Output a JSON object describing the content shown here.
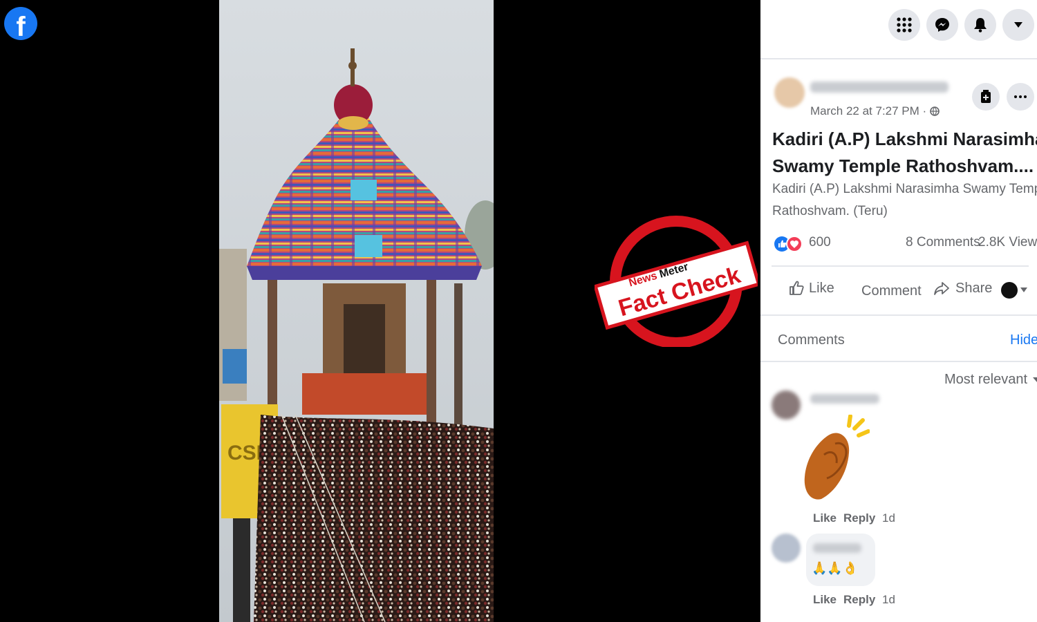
{
  "post": {
    "timestamp": "March 22 at 7:27 PM ·",
    "title": "Kadiri (A.P) Lakshmi Narasimha Swamy Temple Rathoshvam....",
    "title_line1": "Kadiri (A.P) Lakshmi Narasimha",
    "title_line2": "Swamy Temple Rathoshvam....",
    "body_line1": "Kadiri (A.P) Lakshmi Narasimha Swamy Temple",
    "body_line2": "Rathoshvam. (Teru)"
  },
  "stats": {
    "reactions": "600",
    "comments": "8 Comments",
    "views": "2.8K Views"
  },
  "actions": {
    "like": "Like",
    "comment": "Comment",
    "share": "Share"
  },
  "comments_section": {
    "heading": "Comments",
    "hide": "Hide",
    "sort": "Most relevant",
    "items": [
      {
        "like": "Like",
        "reply": "Reply",
        "age": "1d"
      },
      {
        "body": "🙏🙏👌",
        "like": "Like",
        "reply": "Reply",
        "age": "1d"
      }
    ]
  },
  "stamp": {
    "brand_news": "News",
    "brand_meter": "Meter",
    "label": "Fact Check"
  },
  "colors": {
    "facebook_blue": "#1877f2",
    "stamp_red": "#d7141e",
    "panel_bg": "#ffffff"
  },
  "icons": [
    "facebook-logo",
    "grid-menu-icon",
    "messenger-icon",
    "bell-icon",
    "caret-down-icon",
    "save-icon",
    "more-icon",
    "globe-icon",
    "like-reaction-icon",
    "love-reaction-icon",
    "thumbs-up-icon",
    "share-arrow-icon",
    "clapping-hands-emoji"
  ]
}
